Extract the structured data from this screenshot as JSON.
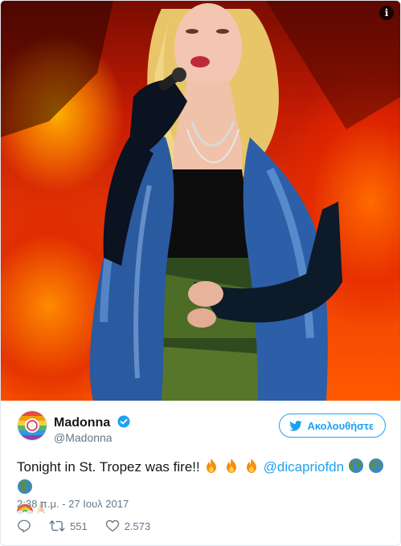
{
  "header": {
    "display_name": "Madonna",
    "handle": "@Madonna",
    "follow_label": "Ακολουθήστε"
  },
  "tweet": {
    "text_before": "Tonight in St. Tropez was fire!!",
    "mention": "@dicapriofdn",
    "timestamp": "2:38 π.μ. - 27 Ιουλ 2017"
  },
  "actions": {
    "retweets": "551",
    "likes": "2.573"
  },
  "icons": {
    "info": "info-icon",
    "verified": "verified-badge-icon",
    "follow": "twitter-bird-icon",
    "reply": "reply-icon",
    "retweet": "retweet-icon",
    "like": "heart-icon",
    "emoji_fire": "fire-emoji",
    "emoji_globe": "globe-emoji",
    "emoji_rainbow": "rainbow-emoji",
    "emoji_pray": "folded-hands-emoji"
  },
  "colors": {
    "accent": "#1da1f2",
    "text": "#14171a",
    "muted": "#657786"
  }
}
